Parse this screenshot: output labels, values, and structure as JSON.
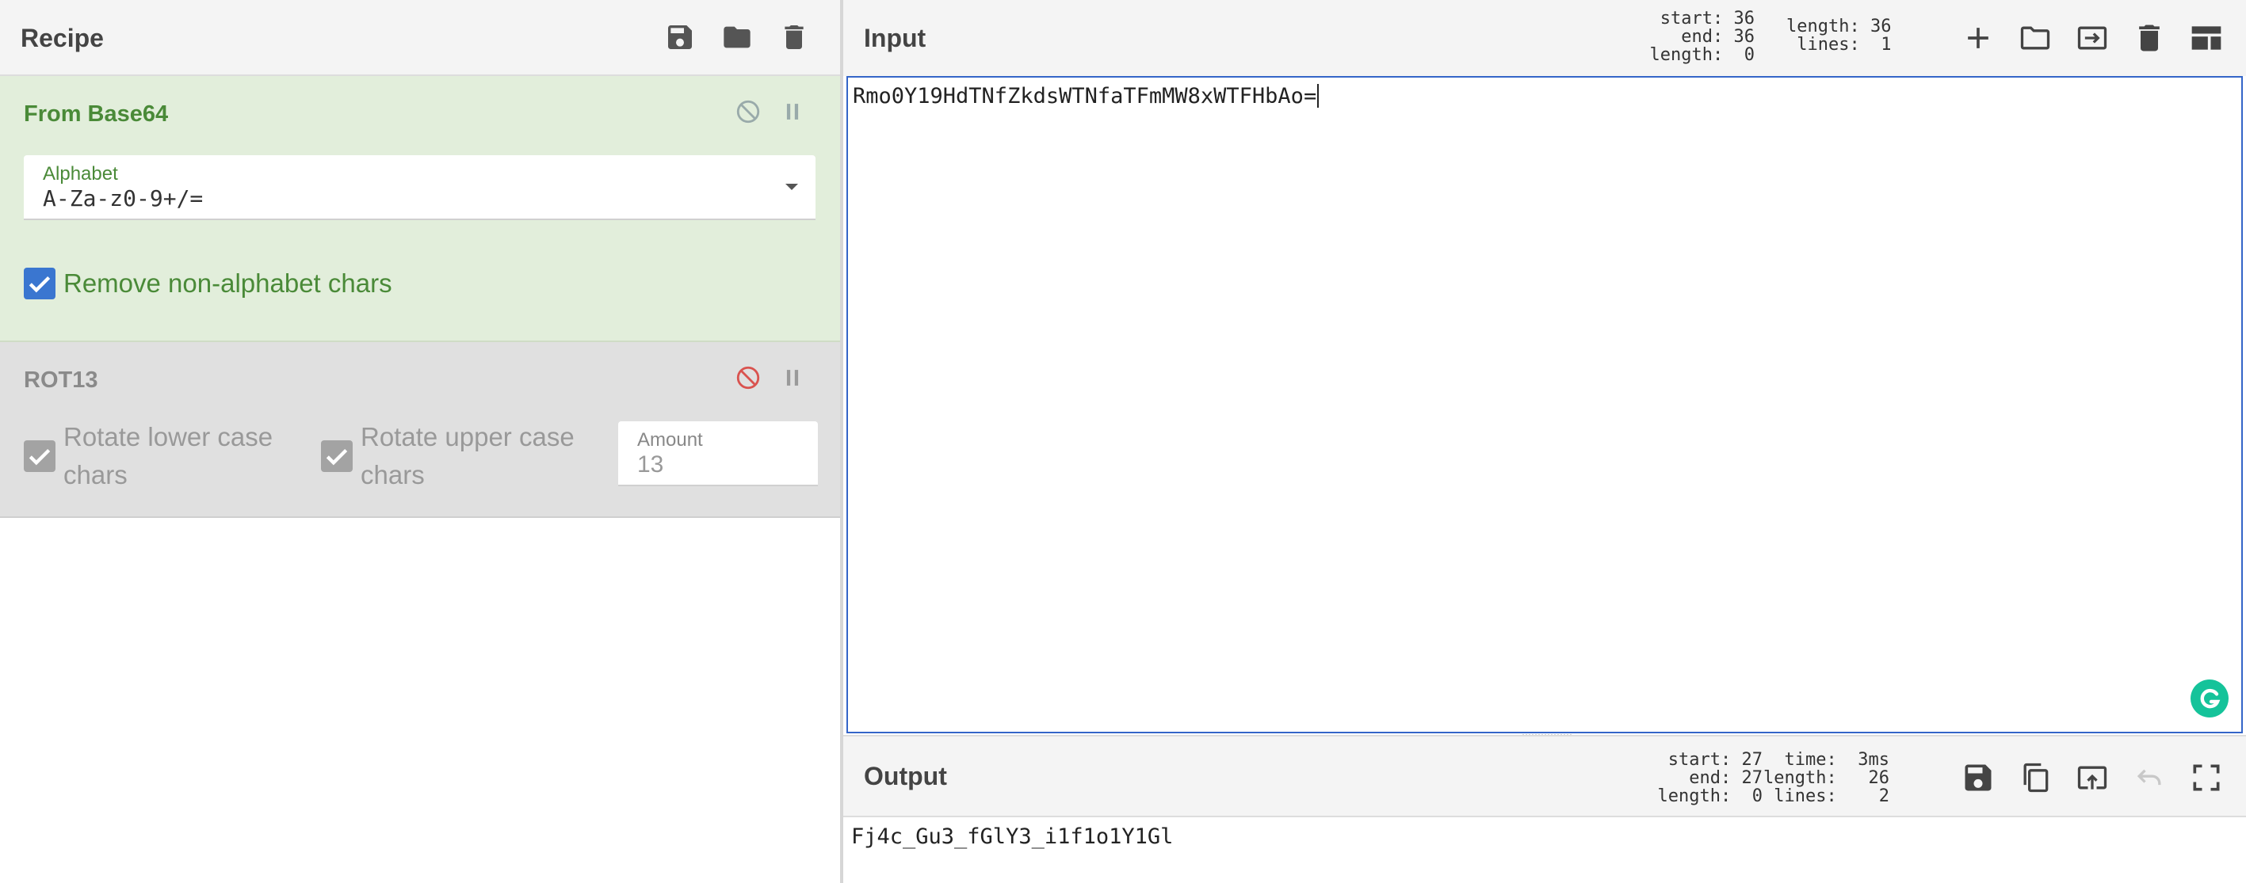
{
  "recipe": {
    "title": "Recipe",
    "header_icons": [
      "save-icon",
      "folder-icon",
      "trash-icon"
    ],
    "operations": [
      {
        "name": "From Base64",
        "state": "enabled",
        "title_color": "#4a8a38",
        "alphabet_label": "Alphabet",
        "alphabet_value": "A-Za-z0-9+/=",
        "remove_nonalpha_label": "Remove non-alphabet chars",
        "remove_nonalpha_checked": true
      },
      {
        "name": "ROT13",
        "state": "disabled",
        "rotate_lower_label": "Rotate lower case chars",
        "rotate_upper_label": "Rotate upper case chars",
        "rotate_lower_checked": true,
        "rotate_upper_checked": true,
        "amount_label": "Amount",
        "amount_value": "13"
      }
    ]
  },
  "input": {
    "title": "Input",
    "stats_selection": "start: 36\n  end: 36\nlength:  0",
    "stats_info": "length: 36\n lines:  1",
    "text": "Rmo0Y19HdTNfZkdsWTNfaTFmMW8xWTFHbAo=",
    "toolbar_icons": [
      "plus-icon",
      "folder-icon",
      "input-to-output-icon",
      "trash-icon",
      "layout-icon"
    ]
  },
  "output": {
    "title": "Output",
    "stats_selection": "start: 27\n  end: 27\nlength:  0",
    "stats_info": "  time:  3ms\nlength:   26\n lines:    2",
    "text": "Fj4c_Gu3_fGlY3_i1f1o1Y1Gl",
    "toolbar_icons": [
      "save-icon",
      "copy-icon",
      "output-to-input-icon",
      "undo-icon",
      "fullscreen-icon"
    ]
  },
  "colors": {
    "accent": "#3465c8",
    "enabled_op_bg": "#e2eedb",
    "disabled_op_bg": "#e0e0e0",
    "checkbox_blue": "#3a76d0",
    "disable_red": "#d9534f",
    "grammarly_green": "#15c39a"
  }
}
